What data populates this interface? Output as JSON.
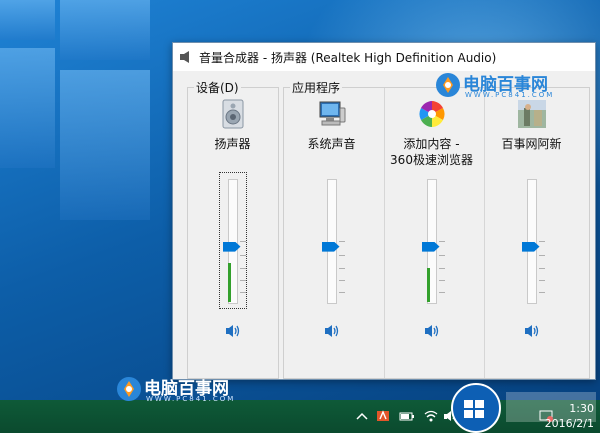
{
  "window": {
    "title": "音量合成器 - 扬声器 (Realtek High Definition Audio)"
  },
  "groups": {
    "device_label": "设备(D)",
    "apps_label": "应用程序"
  },
  "channels": [
    {
      "name": "扬声器",
      "icon": "speaker-device-icon",
      "volume": 0.45,
      "peak": 0.32
    },
    {
      "name": "系统声音",
      "icon": "system-sounds-icon",
      "volume": 0.45,
      "peak": 0
    },
    {
      "name_line1": "添加内容 -",
      "name_line2": "360极速浏览器",
      "icon": "360-browser-icon",
      "volume": 0.45,
      "peak": 0.28
    },
    {
      "name": "百事网阿新",
      "icon": "app-thumbnail-icon",
      "volume": 0.45,
      "peak": 0
    }
  ],
  "watermark": {
    "brand": "电脑百事网",
    "url": "WWW.PC841.COM"
  },
  "taskbar": {
    "time": "1:30",
    "date": "2016/2/1"
  },
  "colors": {
    "accent": "#0078d7",
    "peak": "#33a02c",
    "taskbar": "#0b4a2e"
  }
}
